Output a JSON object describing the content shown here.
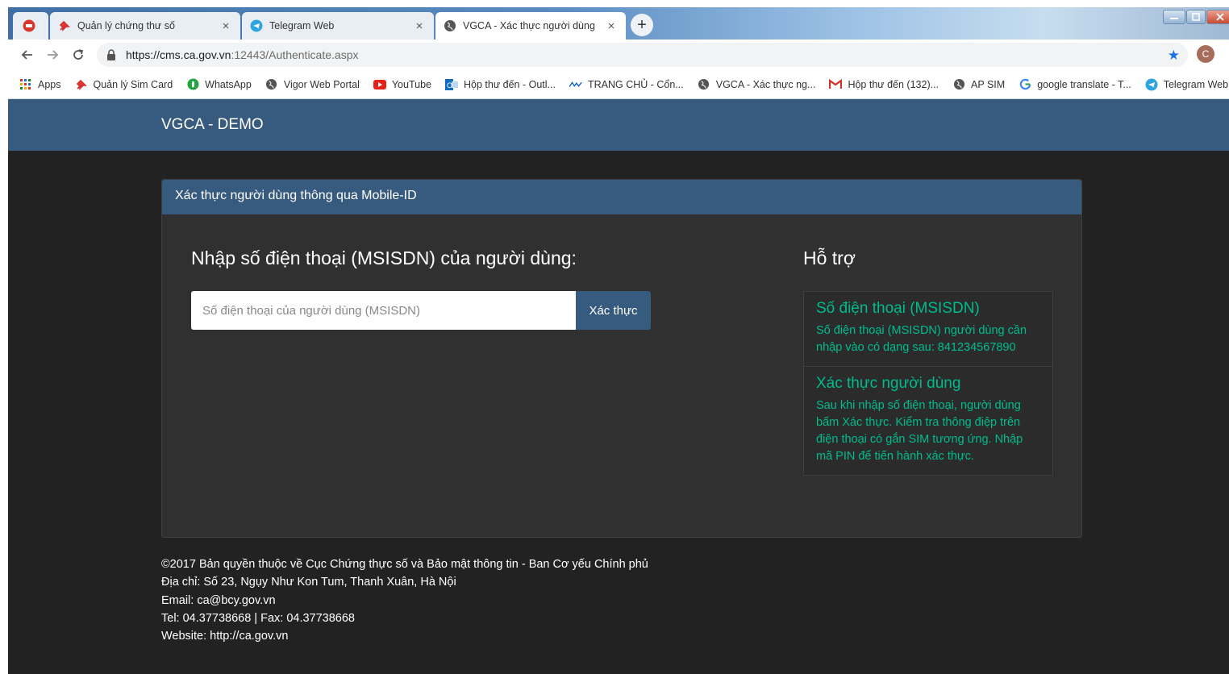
{
  "browser": {
    "tabs": [
      {
        "title": "Quản lý chứng thư số",
        "icon": "pin-icon",
        "active": false
      },
      {
        "title": "Telegram Web",
        "icon": "telegram-icon",
        "active": false
      },
      {
        "title": "VGCA - Xác thực người dùng",
        "icon": "globe-icon",
        "active": true
      }
    ],
    "close_glyph": "×",
    "new_tab_glyph": "+",
    "url": {
      "host": "https://cms.ca.gov.vn",
      "path": ":12443/Authenticate.aspx"
    },
    "profile_initial": "C",
    "bookmarks": [
      {
        "label": "Apps",
        "icon": "apps-grid-icon"
      },
      {
        "label": "Quản lý Sim Card",
        "icon": "pin-icon"
      },
      {
        "label": "WhatsApp",
        "icon": "whatsapp-icon"
      },
      {
        "label": "Vigor Web Portal",
        "icon": "globe-icon"
      },
      {
        "label": "YouTube",
        "icon": "youtube-icon"
      },
      {
        "label": "Hộp thư đến - Outl...",
        "icon": "outlook-icon"
      },
      {
        "label": "TRANG CHỦ - Cổn...",
        "icon": "site-icon"
      },
      {
        "label": "VGCA - Xác thực ng...",
        "icon": "globe-icon"
      },
      {
        "label": "Hộp thư đến (132)...",
        "icon": "gmail-icon"
      },
      {
        "label": "AP SIM",
        "icon": "globe-icon"
      },
      {
        "label": "google translate - T...",
        "icon": "google-icon"
      },
      {
        "label": "Telegram Web",
        "icon": "telegram-icon"
      }
    ]
  },
  "site": {
    "brand": "VGCA - DEMO"
  },
  "panel": {
    "heading": "Xác thực người dùng thông qua Mobile-ID",
    "form_title": "Nhập số điện thoại (MSISDN) của người dùng:",
    "input_placeholder": "Số điện thoại của người dùng (MSISDN)",
    "input_value": "",
    "button_label": "Xác thực",
    "support_title": "Hỗ trợ",
    "support_items": [
      {
        "title": "Số điện thoại (MSISDN)",
        "text": "Số điện thoại (MSISDN) người dùng cần nhập vào có dạng sau: 841234567890"
      },
      {
        "title": "Xác thực người dùng",
        "text": "Sau khi nhập số điện thoại, người dùng bấm Xác thực. Kiểm tra thông điệp trên điện thoại có gắn SIM tương ứng. Nhập mã PIN để tiến hành xác thực."
      }
    ]
  },
  "footer": {
    "copyright": "©2017 Bản quyền thuộc về Cục Chứng thực số và Bảo mật thông tin - Ban Cơ yếu Chính phủ",
    "address": "Địa chỉ: Số 23, Ngụy Như Kon Tum, Thanh Xuân, Hà Nội",
    "email": "Email: ca@bcy.gov.vn",
    "phone": "Tel: 04.37738668 | Fax: 04.37738668",
    "website": "Website: http://ca.gov.vn"
  },
  "colors": {
    "header_bg": "#375a7f",
    "page_bg": "#222222",
    "panel_bg": "#303030",
    "accent_green": "#00bc8c"
  }
}
